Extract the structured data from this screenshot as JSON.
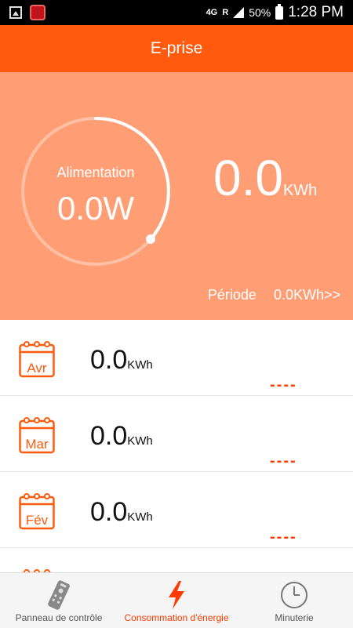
{
  "status_bar": {
    "network_type": "4G",
    "roaming": "R",
    "battery": "50%",
    "time": "1:28 PM"
  },
  "header": {
    "title": "E-prise"
  },
  "summary": {
    "gauge_label": "Alimentation",
    "gauge_value": "0.0W",
    "total_value": "0.0",
    "total_unit": "KWh",
    "period_label": "Période",
    "period_value": "0.0KWh>>"
  },
  "months": [
    {
      "month": "Avr",
      "value": "0.0",
      "unit": "KWh",
      "trend": "----"
    },
    {
      "month": "Mar",
      "value": "0.0",
      "unit": "KWh",
      "trend": "----"
    },
    {
      "month": "Fév",
      "value": "0.0",
      "unit": "KWh",
      "trend": "----"
    },
    {
      "month": "",
      "value": "",
      "unit": "",
      "trend": ""
    }
  ],
  "bottom_nav": {
    "items": [
      {
        "label": "Panneau de contrôle",
        "icon": "remote-control-icon"
      },
      {
        "label": "Consommation d'énergie",
        "icon": "lightning-icon"
      },
      {
        "label": "Minuterie",
        "icon": "clock-icon"
      }
    ],
    "active_index": 1
  },
  "colors": {
    "accent": "#ff5a0e",
    "summary_bg": "#ff9e74",
    "trend": "#ff3b00"
  }
}
